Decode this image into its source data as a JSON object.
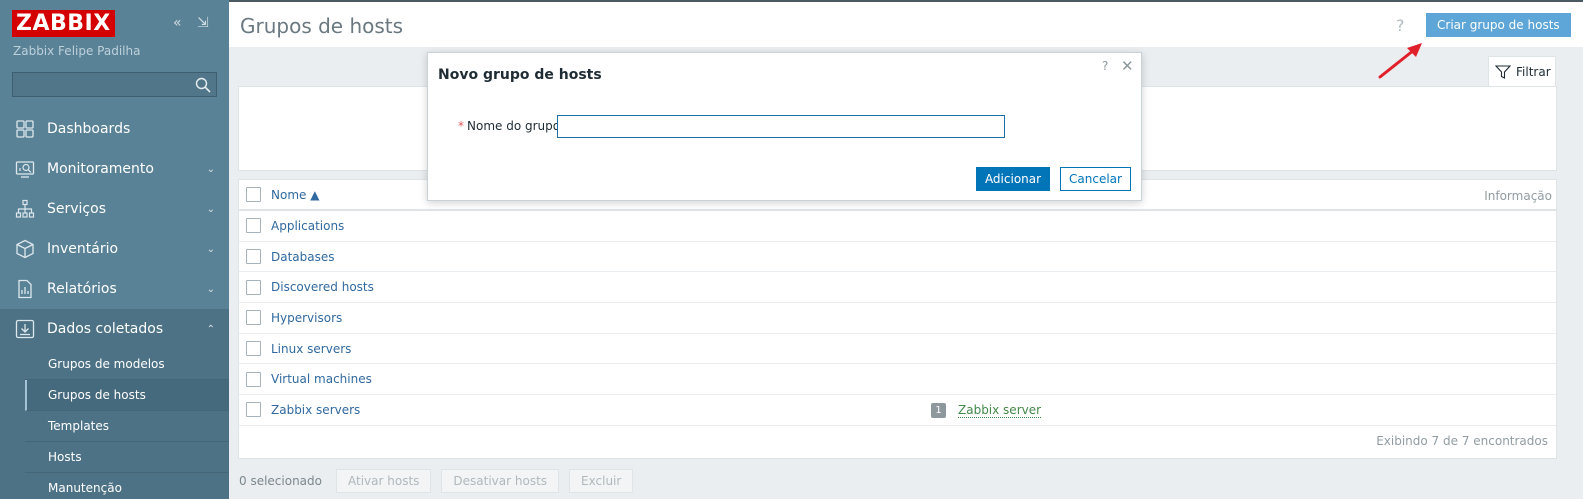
{
  "sidebar": {
    "logo": "ZABBIX",
    "server_name": "Zabbix Felipe Padilha",
    "search_value": "",
    "collapse_glyph": "«",
    "kiosk_glyph": "⇲",
    "nav": [
      {
        "label": "Dashboards",
        "icon": "dashboard-icon"
      },
      {
        "label": "Monitoramento",
        "icon": "monitoring-icon"
      },
      {
        "label": "Serviços",
        "icon": "services-icon"
      },
      {
        "label": "Inventário",
        "icon": "inventory-icon"
      },
      {
        "label": "Relatórios",
        "icon": "reports-icon"
      },
      {
        "label": "Dados coletados",
        "icon": "data-collection-icon"
      }
    ],
    "submenu": [
      {
        "label": "Grupos de modelos"
      },
      {
        "label": "Grupos de hosts",
        "active": true
      },
      {
        "label": "Templates"
      },
      {
        "label": "Hosts"
      },
      {
        "label": "Manutenção"
      }
    ]
  },
  "header": {
    "title": "Grupos de hosts",
    "help": "?",
    "create_button": "Criar grupo de hosts"
  },
  "filter": {
    "label": "Filtrar"
  },
  "table": {
    "columns": {
      "name": "Nome ▲",
      "info": "Informação"
    },
    "rows": [
      {
        "name": "Applications"
      },
      {
        "name": "Databases"
      },
      {
        "name": "Discovered hosts"
      },
      {
        "name": "Hypervisors"
      },
      {
        "name": "Linux servers"
      },
      {
        "name": "Virtual machines"
      },
      {
        "name": "Zabbix servers",
        "host_count": "1",
        "host_name": "Zabbix server"
      }
    ],
    "footer": "Exibindo 7 de 7 encontrados"
  },
  "bottom": {
    "selected": "0 selecionado",
    "buttons": [
      "Ativar hosts",
      "Desativar hosts",
      "Excluir"
    ]
  },
  "modal": {
    "title": "Novo grupo de hosts",
    "help": "?",
    "close": "✕",
    "required_mark": "*",
    "field_label": "Nome do grupo",
    "field_value": "",
    "submit": "Adicionar",
    "cancel": "Cancelar"
  },
  "colors": {
    "sidebar": "#5a8297",
    "logo": "#d40000",
    "primary": "#0275b8",
    "link": "#30699f",
    "annotation_arrow": "#e0202a"
  }
}
